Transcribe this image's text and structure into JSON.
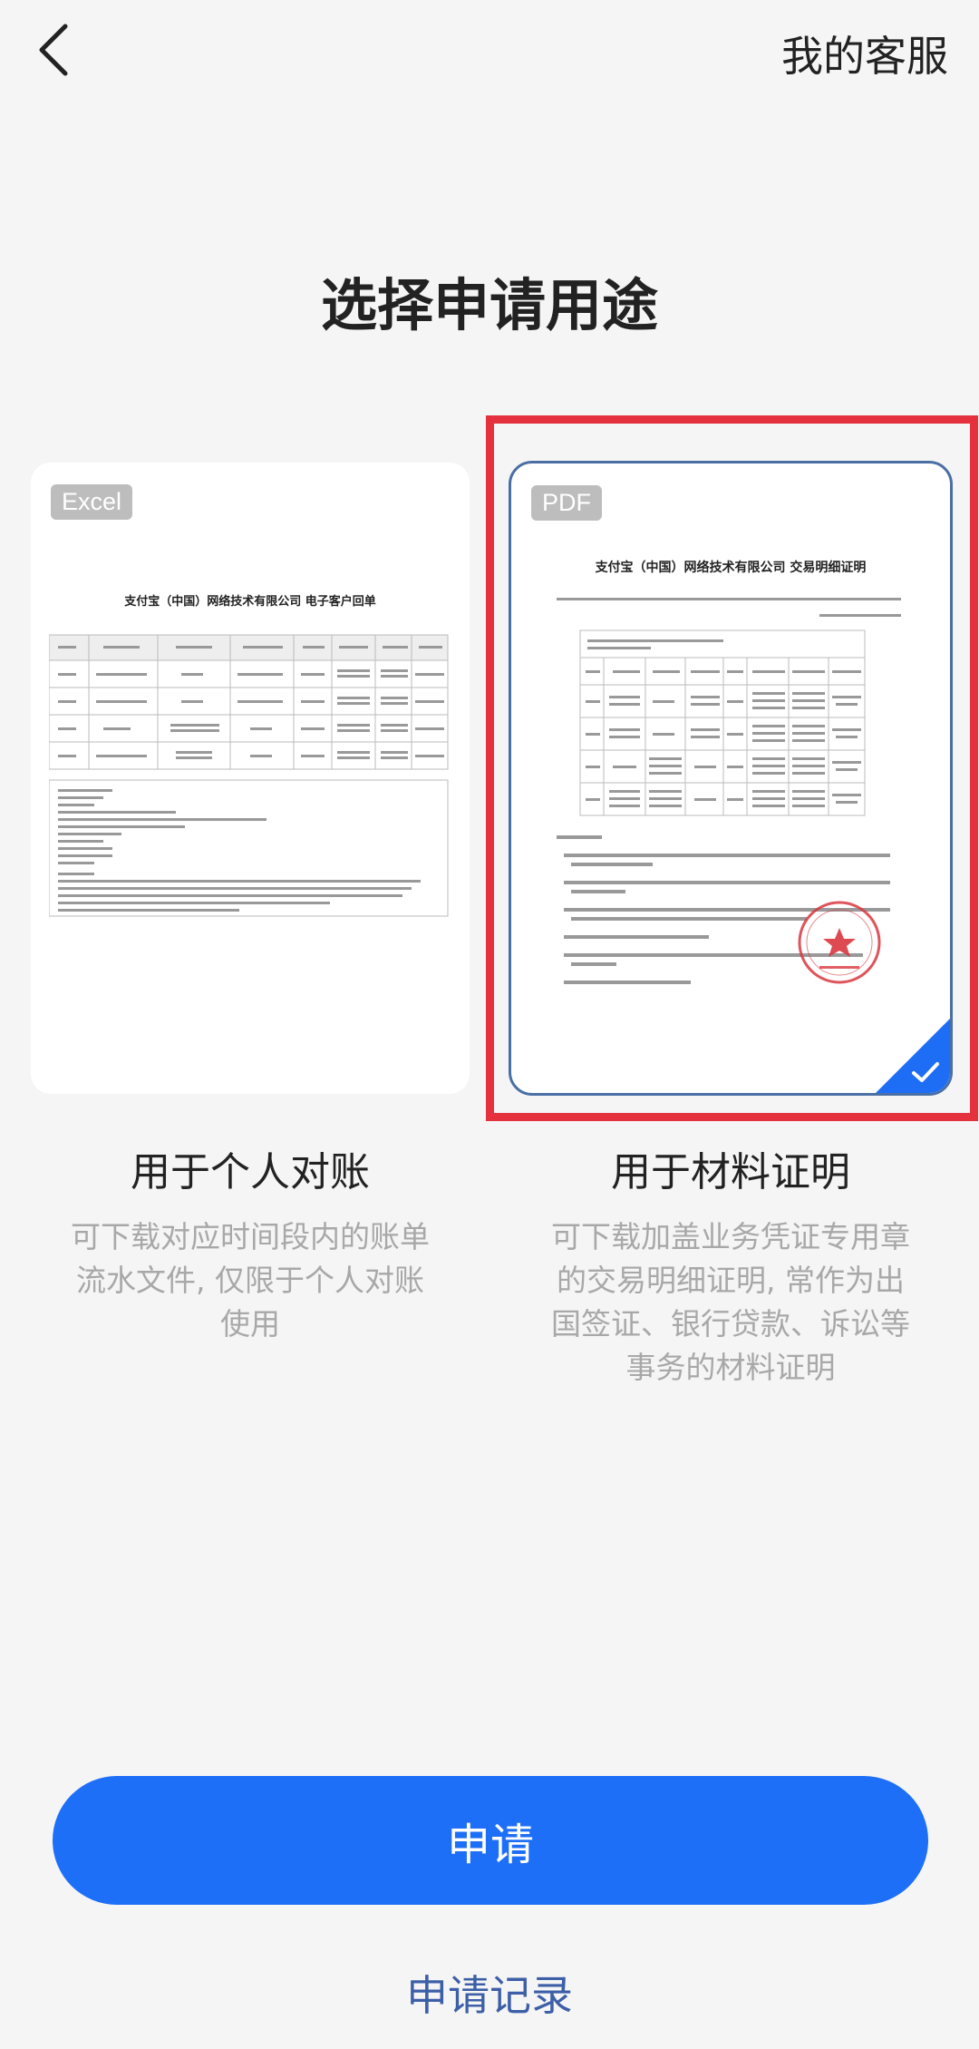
{
  "header": {
    "back_icon": "chevron-left-icon",
    "service_label": "我的客服"
  },
  "page": {
    "title": "选择申请用途"
  },
  "options": [
    {
      "badge": "Excel",
      "doc_title": "支付宝（中国）网络技术有限公司  电子客户回单",
      "title": "用于个人对账",
      "desc_lines": [
        "可下载对应时间段内的账单",
        "流水文件, 仅限于个人对账",
        "使用"
      ],
      "selected": false
    },
    {
      "badge": "PDF",
      "doc_title": "支付宝（中国）网络技术有限公司  交易明细证明",
      "title": "用于材料证明",
      "desc_lines": [
        "可下载加盖业务凭证专用章",
        "的交易明细证明, 常作为出",
        "国签证、银行贷款、诉讼等",
        "事务的材料证明"
      ],
      "selected": true
    }
  ],
  "colors": {
    "accent": "#1e6ff8",
    "selection_border": "#e5303d",
    "link": "#3d5fa8",
    "description": "#a8a8a8"
  },
  "actions": {
    "apply_label": "申请",
    "records_label": "申请记录"
  }
}
